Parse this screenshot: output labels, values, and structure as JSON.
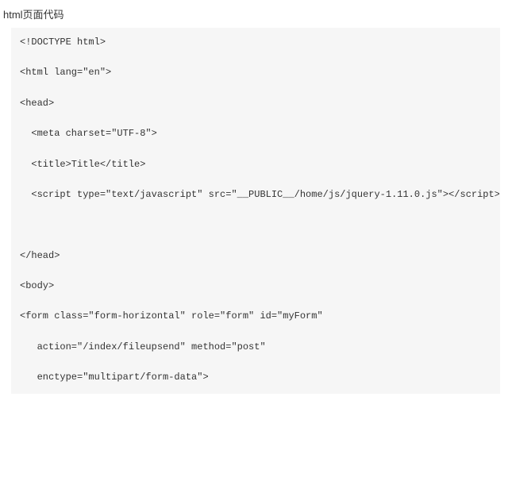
{
  "heading": "html页面代码",
  "code_lines": [
    "<!DOCTYPE html>",
    "",
    "<html lang=\"en\">",
    "",
    "<head>",
    "",
    "  <meta charset=\"UTF-8\">",
    "",
    "  <title>Title</title>",
    "",
    "  <script type=\"text/javascript\" src=\"__PUBLIC__/home/js/jquery-1.11.0.js\"></script>",
    "",
    "",
    "",
    "</head>",
    "",
    "<body>",
    "",
    "<form class=\"form-horizontal\" role=\"form\" id=\"myForm\"",
    "",
    "   action=\"/index/fileupsend\" method=\"post\"",
    "",
    "   enctype=\"multipart/form-data\">"
  ]
}
